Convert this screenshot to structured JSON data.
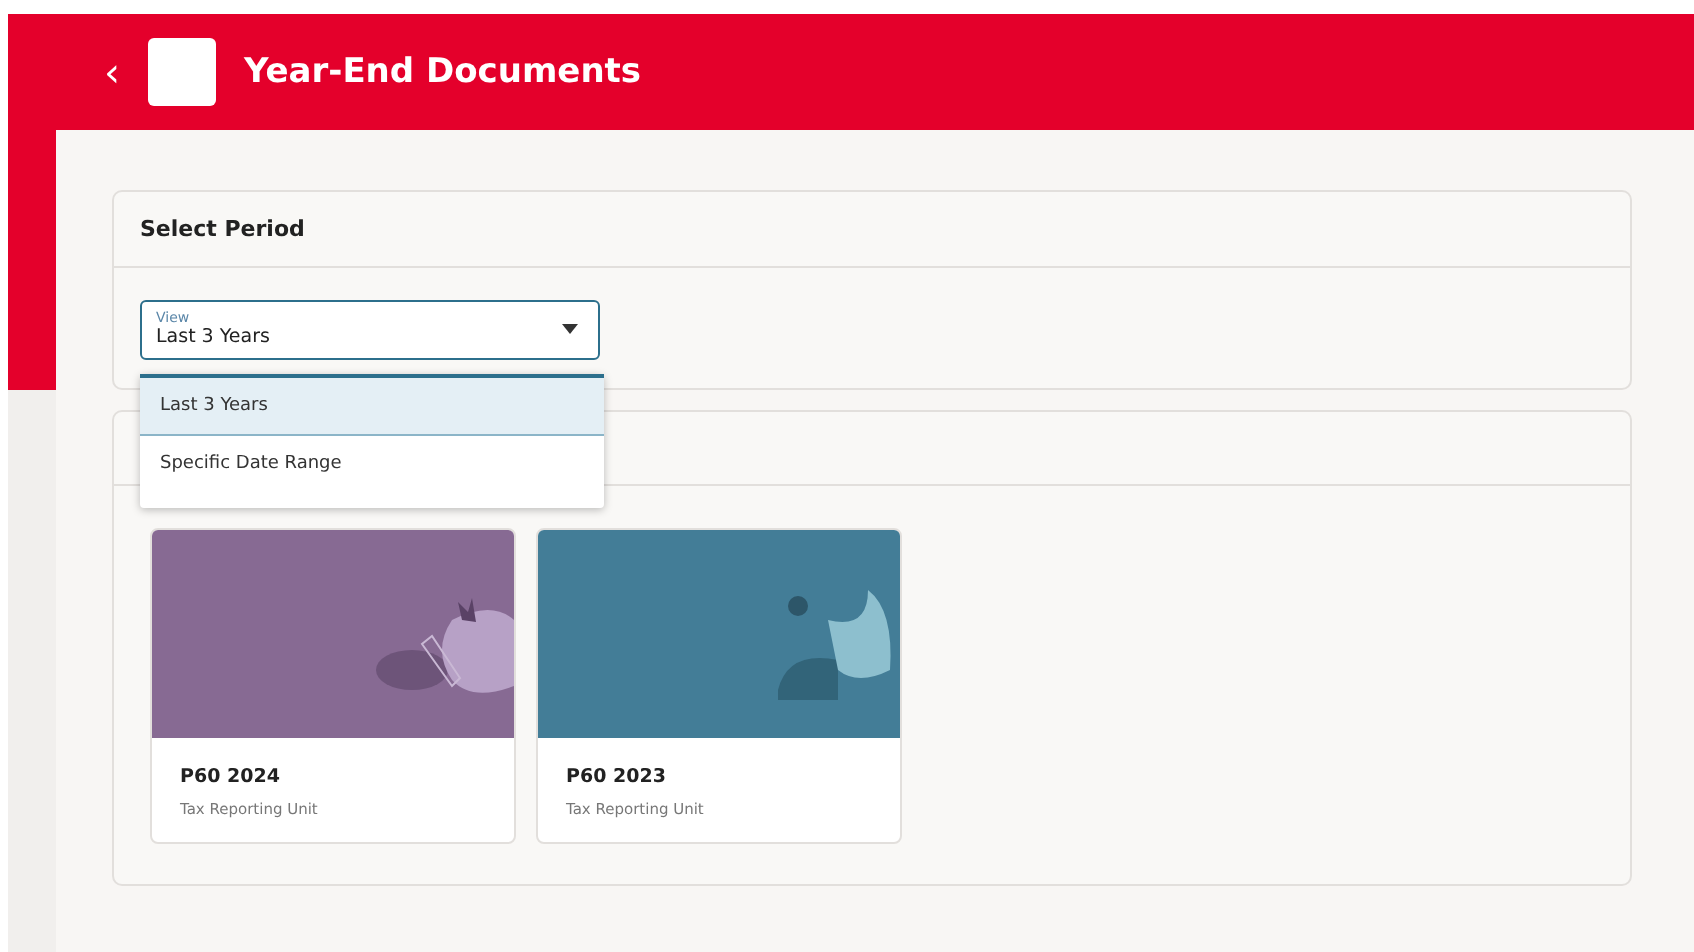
{
  "header": {
    "back": "‹",
    "title": "Year-End Documents"
  },
  "period": {
    "title": "Select Period",
    "field": {
      "label": "View",
      "value": "Last 3 Years",
      "expanded": true
    },
    "options": [
      {
        "label": "Last 3 Years",
        "selected": true
      },
      {
        "label": "Specific Date Range",
        "selected": false
      }
    ]
  },
  "documents": [
    {
      "title": "P60 2024",
      "subtitle": "Tax Reporting Unit",
      "color": "#876a93",
      "kind": "stone"
    },
    {
      "title": "P60 2023",
      "subtitle": "Tax Reporting Unit",
      "color": "#437d97",
      "kind": "leaf"
    }
  ]
}
